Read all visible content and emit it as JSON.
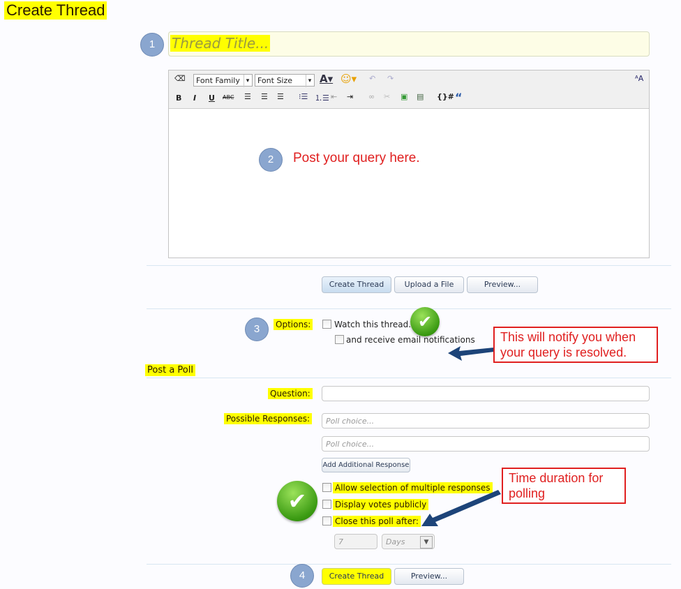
{
  "page_title": "Create Thread",
  "steps": [
    "1",
    "2",
    "3",
    "4"
  ],
  "title_input": {
    "placeholder": "Thread Title..."
  },
  "editor": {
    "font_family": "Font Family",
    "font_size": "Font Size",
    "toolbar_icons": [
      "eraser-icon",
      "text-color-icon",
      "smiley-icon",
      "undo-icon",
      "redo-icon",
      "bold-icon",
      "italic-icon",
      "underline-icon",
      "strikethrough-icon",
      "align-left-icon",
      "align-center-icon",
      "align-right-icon",
      "bullet-list-icon",
      "numbered-list-icon",
      "outdent-icon",
      "indent-icon",
      "link-icon",
      "unlink-icon",
      "image-icon",
      "media-icon",
      "code-icon",
      "quote-icon",
      "font-size-toggle-icon"
    ],
    "annotation": "Post your query here."
  },
  "buttons": {
    "create_thread": "Create Thread",
    "upload": "Upload a File",
    "preview": "Preview..."
  },
  "options": {
    "label": "Options:",
    "watch": "Watch this thread.",
    "email": "and receive email notifications"
  },
  "callout_notify": "This will notify you when your query is resolved.",
  "poll": {
    "heading": "Post a Poll",
    "question_label": "Question:",
    "responses_label": "Possible Responses:",
    "choice_placeholder": "Poll choice...",
    "add_response": "Add Additional Response",
    "multiple": "Allow selection of multiple responses",
    "public": "Display votes publicly",
    "close_after": "Close this poll after:",
    "duration_value": "7",
    "duration_unit": "Days"
  },
  "callout_duration": "Time duration  for polling",
  "colors": {
    "highlight": "#ffff00",
    "callout": "#e02020",
    "step_badge": "#8aa6cf"
  }
}
